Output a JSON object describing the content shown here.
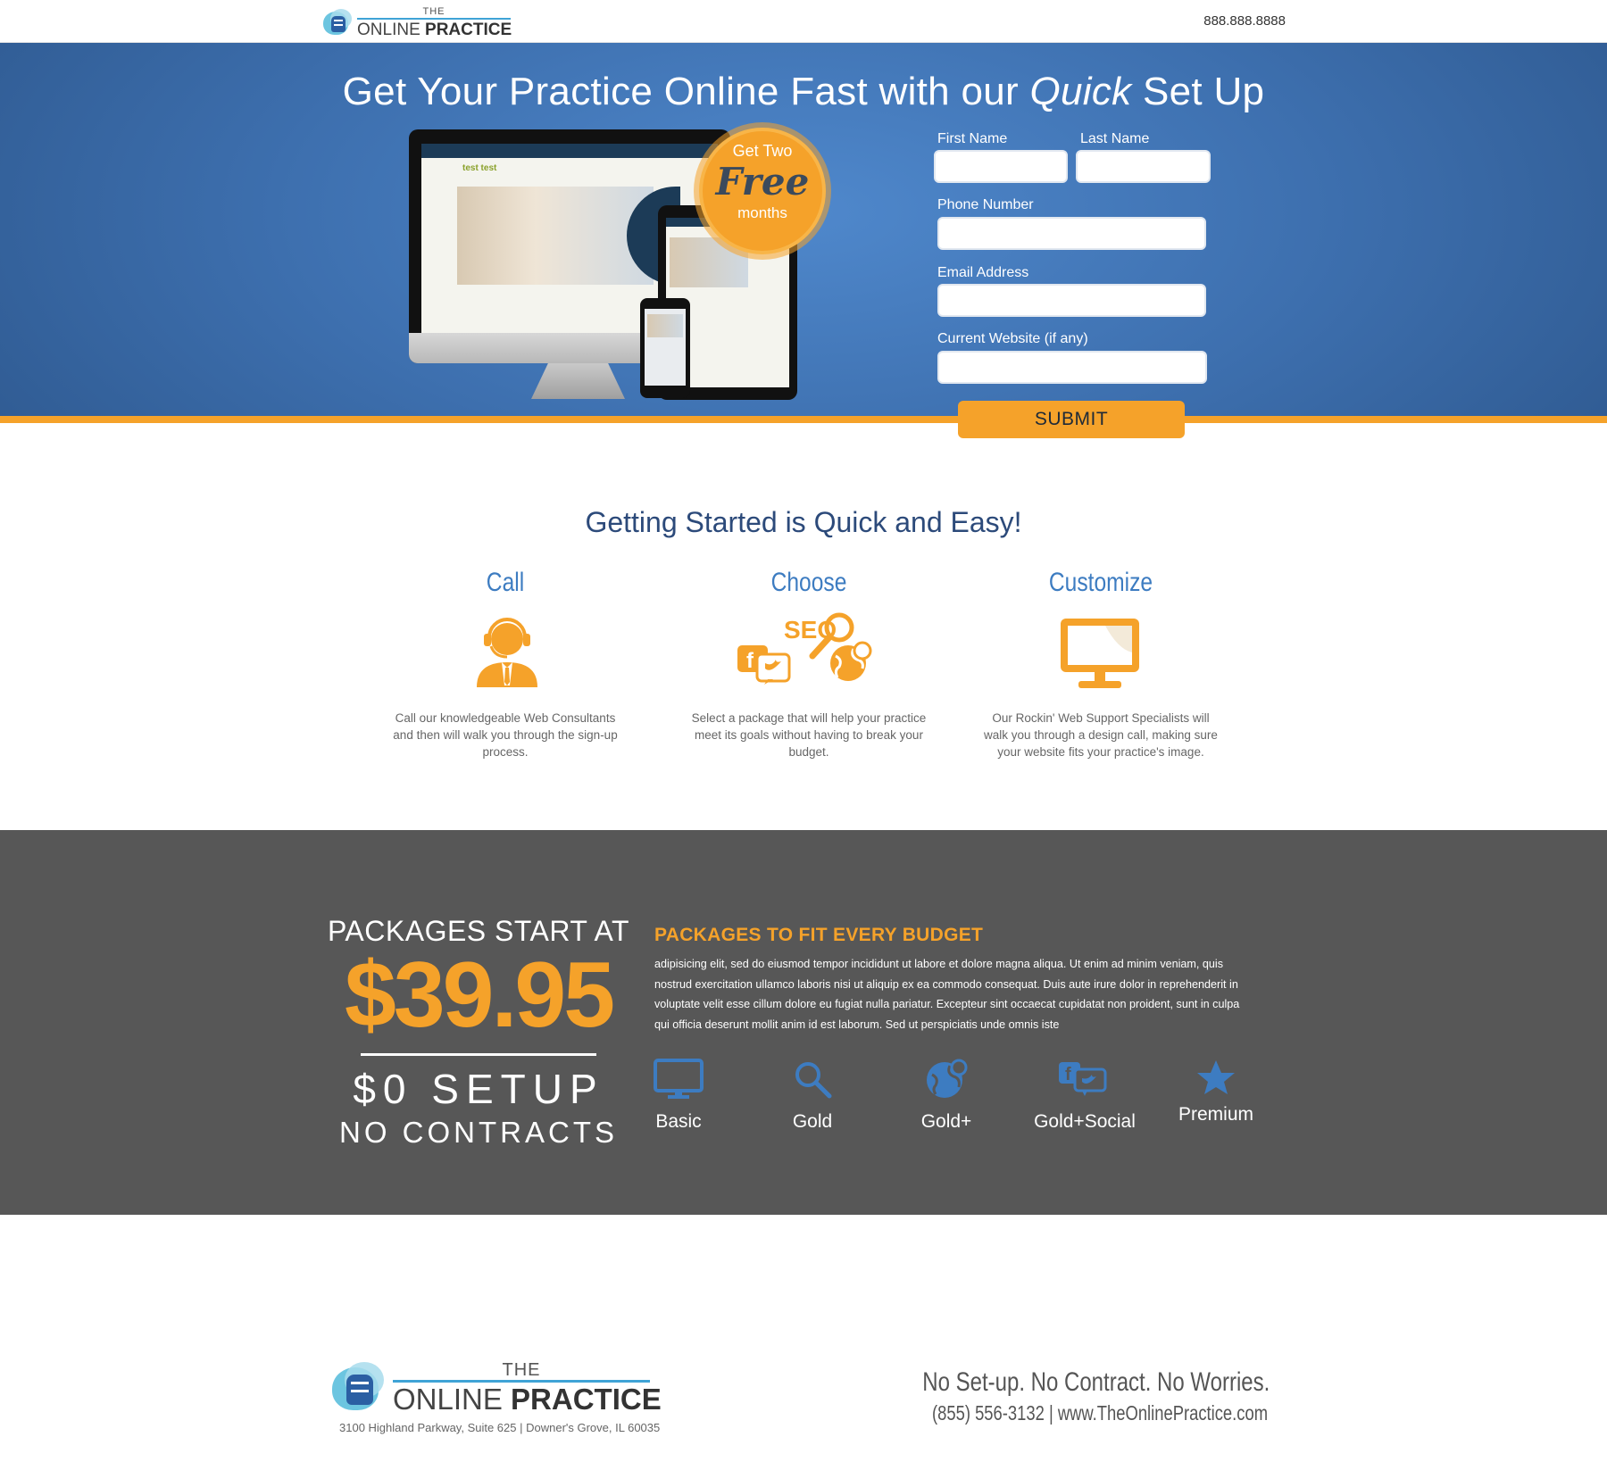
{
  "header": {
    "logo_the": "THE",
    "logo_online": "ONLINE ",
    "logo_practice": "PRACTICE",
    "phone": "888.888.8888"
  },
  "hero": {
    "title_start": "Get Your Practice Online Fast with our ",
    "title_italic": "Quick",
    "title_end": " Set Up",
    "badge_line1": "Get Two",
    "badge_line2": "Free",
    "badge_line3": "months",
    "mockup_site_title": "test test"
  },
  "form": {
    "first_name_label": "First Name",
    "last_name_label": "Last Name",
    "phone_label": "Phone Number",
    "email_label": "Email Address",
    "website_label": "Current Website (if any)",
    "submit_label": "SUBMIT"
  },
  "getting_started": {
    "title": "Getting Started is Quick and Easy!",
    "steps": [
      {
        "title": "Call",
        "icon": "headset-user-icon",
        "desc": "Call our knowledgeable Web Consultants and then will walk you through the sign-up process."
      },
      {
        "title": "Choose",
        "icon": "seo-social-icon",
        "desc": "Select a package that will help your practice meet its goals without having to break your budget."
      },
      {
        "title": "Customize",
        "icon": "monitor-icon",
        "desc": "Our Rockin' Web Support Specialists will walk you through a design call, making sure your website fits your practice's image."
      }
    ],
    "seo_text": "SEO"
  },
  "packages": {
    "start_label": "PACKAGES START AT",
    "price": "$39.95",
    "setup": "$0 SETUP",
    "contracts": "NO CONTRACTS",
    "heading": "PACKAGES TO FIT EVERY BUDGET",
    "text": "adipisicing elit, sed do eiusmod tempor incididunt ut labore et dolore magna aliqua. Ut enim ad minim veniam, quis nostrud exercitation ullamco laboris nisi ut aliquip ex ea commodo consequat. Duis aute irure dolor in reprehenderit in voluptate velit esse cillum dolore eu fugiat nulla pariatur. Excepteur sint occaecat cupidatat non proident, sunt in culpa qui officia deserunt mollit anim id est laborum. Sed ut perspiciatis unde omnis iste",
    "tiers": [
      {
        "label": "Basic",
        "icon": "monitor-icon"
      },
      {
        "label": "Gold",
        "icon": "search-icon"
      },
      {
        "label": "Gold+",
        "icon": "globe-icon"
      },
      {
        "label": "Gold+Social",
        "icon": "social-icon"
      },
      {
        "label": "Premium",
        "icon": "star-icon"
      }
    ],
    "accent": "#f5a22a",
    "icon_blue": "#3d7cc1"
  },
  "footer": {
    "address": "3100 Highland Parkway, Suite 625 | Downer's Grove, IL 60035",
    "slogan": "No Set-up. No Contract. No Worries.",
    "contact": "(855) 556-3132 | www.TheOnlinePractice.com"
  }
}
